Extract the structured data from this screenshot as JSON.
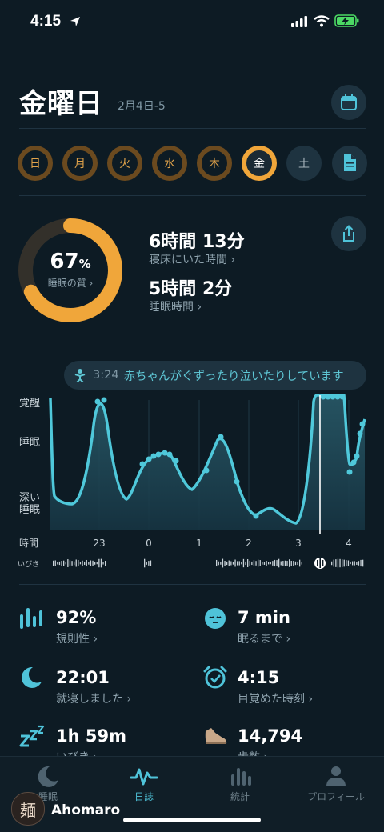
{
  "status": {
    "time": "4:15"
  },
  "header": {
    "day": "金曜日",
    "date_range": "2月4日-5"
  },
  "week": [
    {
      "label": "日",
      "state": "done"
    },
    {
      "label": "月",
      "state": "done"
    },
    {
      "label": "火",
      "state": "done"
    },
    {
      "label": "水",
      "state": "done"
    },
    {
      "label": "木",
      "state": "done"
    },
    {
      "label": "金",
      "state": "active"
    },
    {
      "label": "土",
      "state": "future"
    }
  ],
  "summary": {
    "quality_value": "67",
    "quality_unit": "%",
    "quality_label": "睡眠の質 ›",
    "quality_fraction": 0.67,
    "time_in_bed": "6時間 13分",
    "time_in_bed_label": "寝床にいた時間 ›",
    "sleep_time": "5時間 2分",
    "sleep_time_label": "睡眠時間 ›"
  },
  "snore_note": {
    "time": "3:24",
    "text": "赤ちゃんがぐずったり泣いたりしています"
  },
  "graph": {
    "y_labels": [
      "覚醒",
      "睡眠",
      "深い",
      "睡眠"
    ],
    "x_title": "時間",
    "x_ticks": [
      "23",
      "0",
      "1",
      "2",
      "3",
      "4"
    ],
    "snore_label": "いびき"
  },
  "stats": [
    {
      "value": "92%",
      "label": "規則性 ›",
      "icon": "bars-icon"
    },
    {
      "value": "7 min",
      "label": "眠るまで ›",
      "icon": "sleepy-face-icon"
    },
    {
      "value": "22:01",
      "label": "就寝しました ›",
      "icon": "moon-icon"
    },
    {
      "value": "4:15",
      "label": "目覚めた時刻 ›",
      "icon": "alarm-icon"
    },
    {
      "value": "1h 59m",
      "label": "いびき ›",
      "icon": "zzz-icon"
    },
    {
      "value": "14,794",
      "label": "歩数 ›",
      "icon": "shoe-icon"
    }
  ],
  "tabs": [
    {
      "label": "睡眠",
      "icon": "moon-icon",
      "active": false
    },
    {
      "label": "日誌",
      "icon": "wave-icon",
      "active": true
    },
    {
      "label": "統計",
      "icon": "bars-icon",
      "active": false
    },
    {
      "label": "プロフィール",
      "icon": "person-icon",
      "active": false
    }
  ],
  "watermark": {
    "name": "Ahomaro",
    "avatar_text": "麺"
  },
  "colors": {
    "accent": "#4fc3d9",
    "ring": "#f0a63a",
    "background": "#0d1b24"
  }
}
